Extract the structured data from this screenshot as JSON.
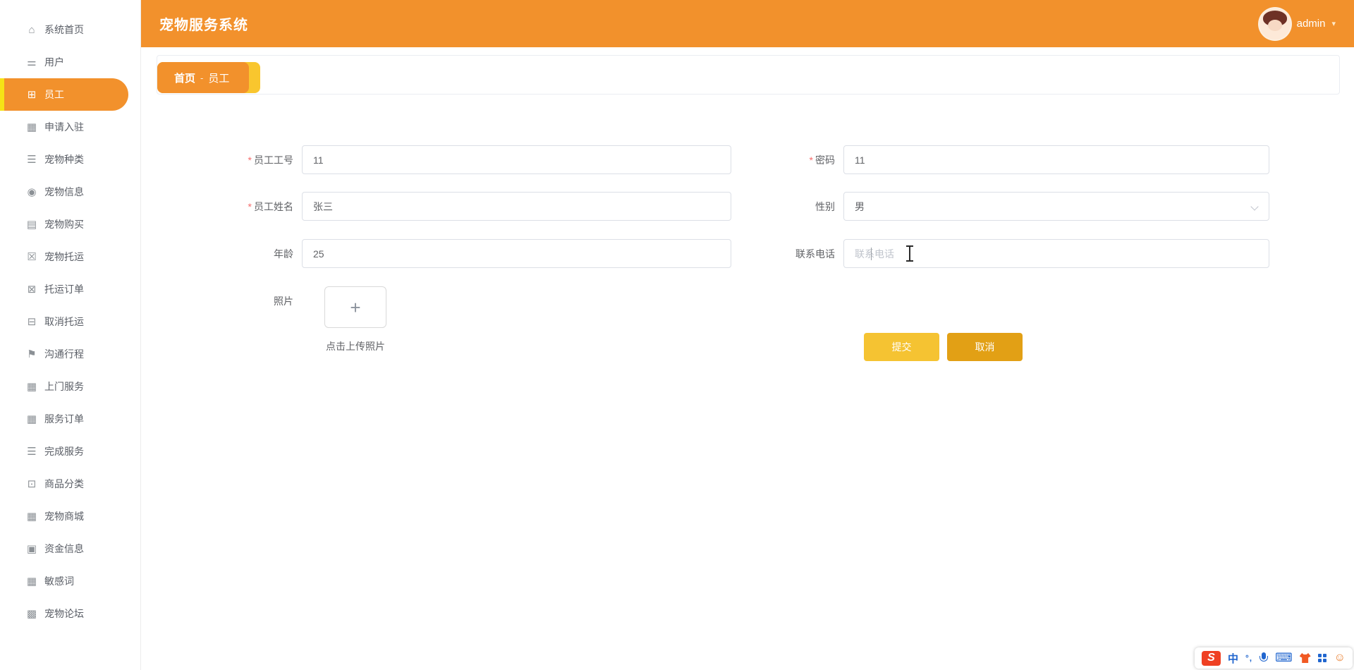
{
  "app": {
    "title": "宠物服务系统"
  },
  "header": {
    "username": "admin",
    "caret": "▾"
  },
  "sidebar": {
    "items": [
      {
        "id": "system-home",
        "label": "系统首页",
        "icon": "home-icon",
        "glyph": "⌂",
        "active": false
      },
      {
        "id": "users",
        "label": "用户",
        "icon": "sliders-icon",
        "glyph": "⚌",
        "active": false
      },
      {
        "id": "employees",
        "label": "员工",
        "icon": "grid-icon",
        "glyph": "⊞",
        "active": true
      },
      {
        "id": "apply-settle",
        "label": "申请入驻",
        "icon": "grid-icon",
        "glyph": "▦",
        "active": false
      },
      {
        "id": "pet-types",
        "label": "宠物种类",
        "icon": "list-icon",
        "glyph": "☰",
        "active": false
      },
      {
        "id": "pet-info",
        "label": "宠物信息",
        "icon": "pin-icon",
        "glyph": "◉",
        "active": false
      },
      {
        "id": "pet-purchase",
        "label": "宠物购买",
        "icon": "book-icon",
        "glyph": "▤",
        "active": false
      },
      {
        "id": "pet-shipping",
        "label": "宠物托运",
        "icon": "clipboard-x-icon",
        "glyph": "☒",
        "active": false
      },
      {
        "id": "shipping-orders",
        "label": "托运订单",
        "icon": "ticket-icon",
        "glyph": "⊠",
        "active": false
      },
      {
        "id": "cancel-shipping",
        "label": "取消托运",
        "icon": "message-icon",
        "glyph": "⊟",
        "active": false
      },
      {
        "id": "trip-comm",
        "label": "沟通行程",
        "icon": "flag-icon",
        "glyph": "⚑",
        "active": false
      },
      {
        "id": "door-service",
        "label": "上门服务",
        "icon": "grid-icon",
        "glyph": "▦",
        "active": false
      },
      {
        "id": "service-orders",
        "label": "服务订单",
        "icon": "grid-icon",
        "glyph": "▦",
        "active": false
      },
      {
        "id": "done-service",
        "label": "完成服务",
        "icon": "list-icon",
        "glyph": "☰",
        "active": false
      },
      {
        "id": "goods-category",
        "label": "商品分类",
        "icon": "monitor-icon",
        "glyph": "⊡",
        "active": false
      },
      {
        "id": "pet-mall",
        "label": "宠物商城",
        "icon": "grid-icon",
        "glyph": "▦",
        "active": false
      },
      {
        "id": "fund-info",
        "label": "资金信息",
        "icon": "clipboard-icon",
        "glyph": "▣",
        "active": false
      },
      {
        "id": "sensitive-words",
        "label": "敏感词",
        "icon": "grid-icon",
        "glyph": "▦",
        "active": false
      },
      {
        "id": "pet-forum",
        "label": "宠物论坛",
        "icon": "grid-9-icon",
        "glyph": "▩",
        "active": false
      }
    ]
  },
  "breadcrumb": {
    "home": "首页",
    "separator": "-",
    "current": "员工"
  },
  "form": {
    "fields": {
      "employee_id": {
        "label": "员工工号",
        "mark": "*",
        "value": "11"
      },
      "password": {
        "label": "密码",
        "mark": "*",
        "value": "11"
      },
      "employee_name": {
        "label": "员工姓名",
        "mark": "*",
        "value": "张三"
      },
      "gender": {
        "label": "性别",
        "mark": "",
        "value": "男"
      },
      "age": {
        "label": "年龄",
        "mark": "",
        "value": "25"
      },
      "phone": {
        "label": "联系电话",
        "mark": "",
        "value": "",
        "placeholder": "联系电话"
      }
    },
    "photo": {
      "label": "照片",
      "plus_sign": "+",
      "hint": "点击上传照片"
    },
    "buttons": {
      "submit": "提交",
      "cancel": "取消"
    }
  },
  "ime": {
    "sogou": "S",
    "chinese_mode": "中",
    "punctuation": "°,",
    "keyboard": "⌨",
    "emoji": "☺"
  },
  "colors": {
    "primary_orange": "#f2912c",
    "accent_yellow": "#f6e315",
    "submit_yellow": "#f5c332",
    "cancel_amber": "#e2a015",
    "required_red": "#f56c6c"
  }
}
